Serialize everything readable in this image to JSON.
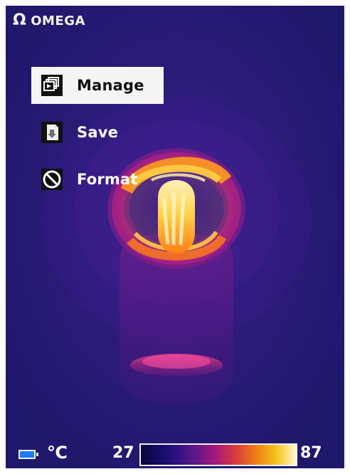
{
  "brand": {
    "logo_symbol": "Ω",
    "name": "OMEGA"
  },
  "menu": {
    "items": [
      {
        "label": "Manage",
        "icon": "gallery-icon",
        "selected": true
      },
      {
        "label": "Save",
        "icon": "save-file-icon",
        "selected": false
      },
      {
        "label": "Format",
        "icon": "no-entry-icon",
        "selected": false
      }
    ]
  },
  "status": {
    "unit": "℃",
    "range_min": "27",
    "range_max": "87"
  },
  "colors": {
    "screen_bg": "#241a6e",
    "selection_bg": "#f5f5f5",
    "hotspot_yellow": "#ffd24a",
    "battery_blue": "#1a7bff"
  }
}
